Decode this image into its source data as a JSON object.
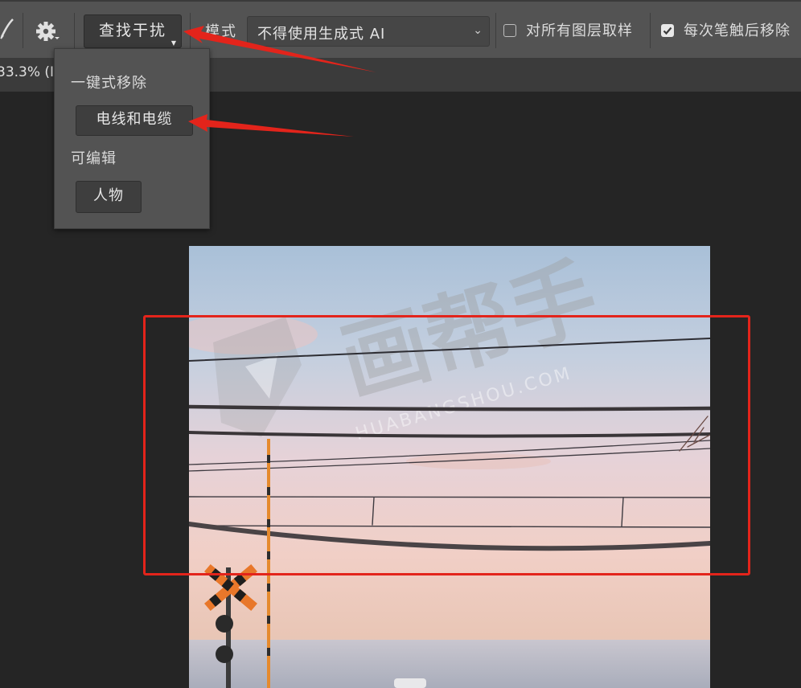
{
  "toolbar": {
    "find_button_label": "查找干扰",
    "mode_label": "模式",
    "mode_value": "不得使用生成式 AI",
    "sample_all_layers": {
      "label": "对所有图层取样",
      "checked": false
    },
    "remove_after_stroke": {
      "label": "每次笔触后移除",
      "checked": true
    }
  },
  "document_tab": {
    "label": "33.3% (I"
  },
  "dropdown": {
    "one_click_heading": "一键式移除",
    "wires_button": "电线和电缆",
    "editable_heading": "可编辑",
    "people_button": "人物"
  },
  "watermark": {
    "brand": "画帮手",
    "domain": "HUABANGSHOU.COM"
  },
  "colors": {
    "annotation_red": "#e3241b",
    "toolbar_bg": "#535353",
    "canvas_bg": "#252525"
  }
}
